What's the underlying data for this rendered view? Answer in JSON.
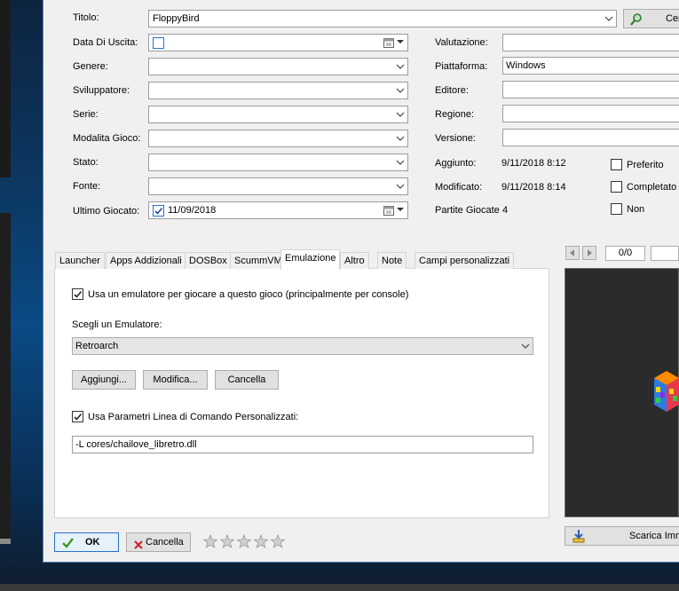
{
  "form": {
    "titolo_label": "Titolo:",
    "titolo_value": "FloppyBird",
    "search_button_label": "Cer",
    "data_uscita_label": "Data Di Uscita:",
    "genere_label": "Genere:",
    "sviluppatore_label": "Sviluppatore:",
    "serie_label": "Serie:",
    "modalita_label": "Modalita Gioco:",
    "stato_label": "Stato:",
    "fonte_label": "Fonte:",
    "ultimo_giocato_label": "Ultimo Giocato:",
    "ultimo_giocato_value": "11/09/2018",
    "valutazione_label": "Valutazione:",
    "piattaforma_label": "Piattaforma:",
    "piattaforma_value": "Windows",
    "editore_label": "Editore:",
    "regione_label": "Regione:",
    "versione_label": "Versione:",
    "aggiunto_label": "Aggiunto:",
    "aggiunto_value": "9/11/2018 8:12",
    "modificato_label": "Modificato:",
    "modificato_value": "9/11/2018 8:14",
    "partite_label": "Partite Giocate",
    "partite_value": "4",
    "preferito_label": "Preferito",
    "completato_label": "Completato",
    "non_label": "Non"
  },
  "tabs": [
    "Launcher",
    "Apps Addizionali",
    "DOSBox",
    "ScummVM",
    "Emulazione",
    "Altro",
    "Note",
    "Campi personalizzati"
  ],
  "emulation": {
    "use_emulator_label": "Usa un emulatore per giocare a questo gioco (principalmente per console)",
    "choose_label": "Scegli un Emulatore:",
    "emulator_value": "Retroarch",
    "add_button": "Aggiungi...",
    "edit_button": "Modifica...",
    "delete_button": "Cancella",
    "custom_params_label": "Usa Parametri Linea di Comando Personalizzati:",
    "params_value": "-L cores/chailove_libretro.dll"
  },
  "images": {
    "counter": "0/0",
    "download_button": "Scarica Imm"
  },
  "footer": {
    "ok_label": "OK",
    "cancel_label": "Cancella",
    "rating_stars": 5,
    "rating_value": 0
  },
  "colors": {
    "accent_blue": "#2a6fd1",
    "ok_check_green": "#3a9a22",
    "cancel_x_red": "#d02020"
  }
}
